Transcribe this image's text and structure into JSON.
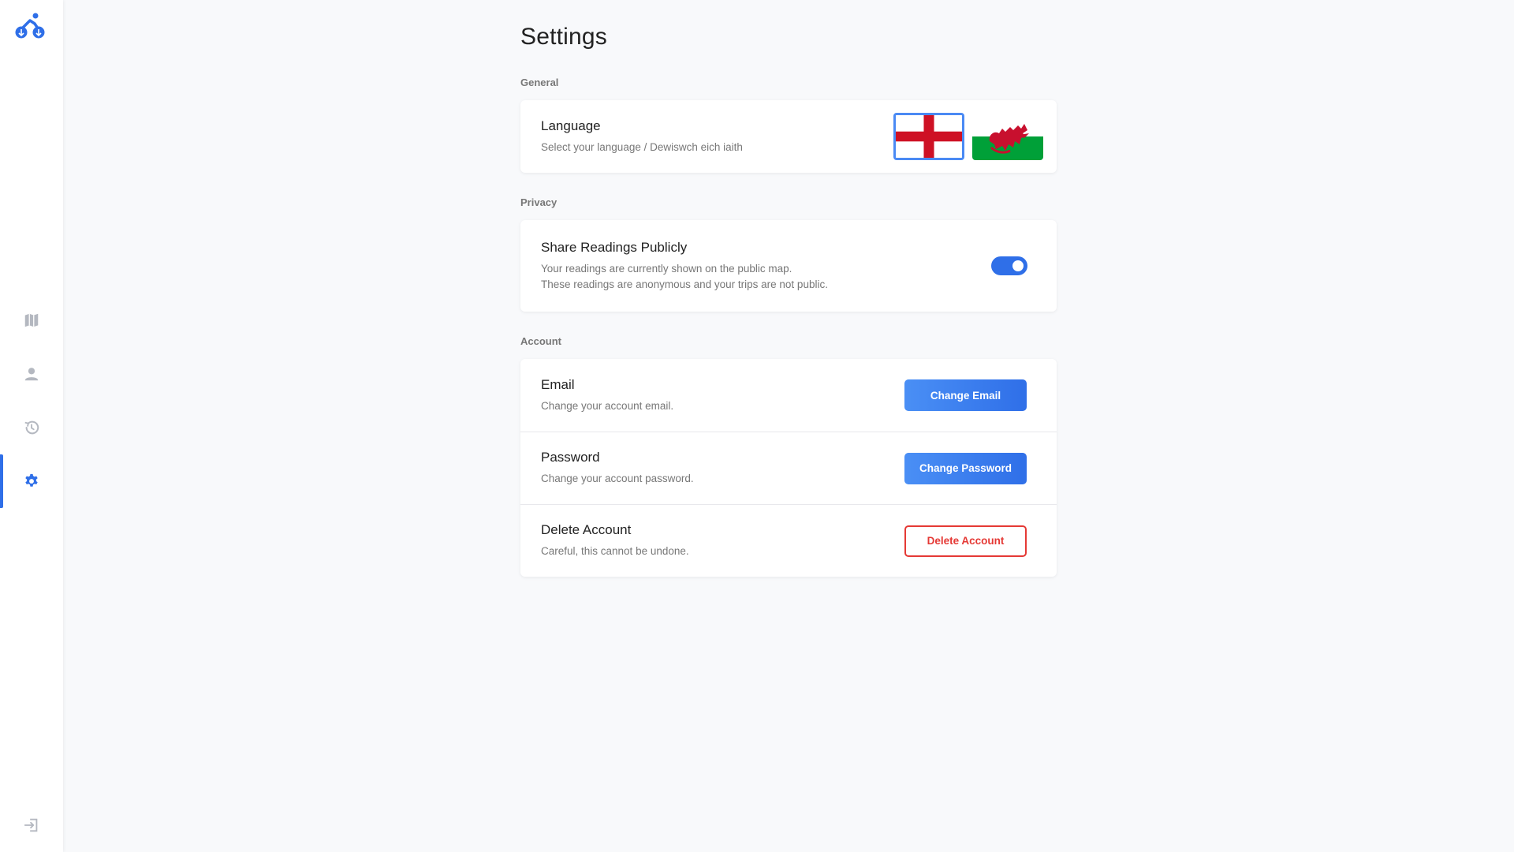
{
  "sidebar": {
    "logo_icon": "cyclist-logo-icon",
    "items": [
      {
        "icon": "map-icon",
        "active": false
      },
      {
        "icon": "user-icon",
        "active": false
      },
      {
        "icon": "history-icon",
        "active": false
      },
      {
        "icon": "gear-icon",
        "active": true
      }
    ],
    "logout_icon": "logout-icon"
  },
  "page": {
    "title": "Settings"
  },
  "sections": {
    "general": {
      "label": "General",
      "language": {
        "title": "Language",
        "description": "Select your language / Dewiswch eich iaith",
        "options": [
          {
            "flag": "england-flag",
            "selected": true
          },
          {
            "flag": "wales-flag",
            "selected": false
          }
        ]
      }
    },
    "privacy": {
      "label": "Privacy",
      "share": {
        "title": "Share Readings Publicly",
        "description_line1": "Your readings are currently shown on the public map.",
        "description_line2": "These readings are anonymous and your trips are not public.",
        "enabled": true
      }
    },
    "account": {
      "label": "Account",
      "email": {
        "title": "Email",
        "description": "Change your account email.",
        "button": "Change Email"
      },
      "password": {
        "title": "Password",
        "description": "Change your account password.",
        "button": "Change Password"
      },
      "delete": {
        "title": "Delete Account",
        "description": "Careful, this cannot be undone.",
        "button": "Delete Account"
      }
    }
  },
  "colors": {
    "accent": "#2f6fe8",
    "danger": "#e53935",
    "background": "#f8f9fb"
  }
}
